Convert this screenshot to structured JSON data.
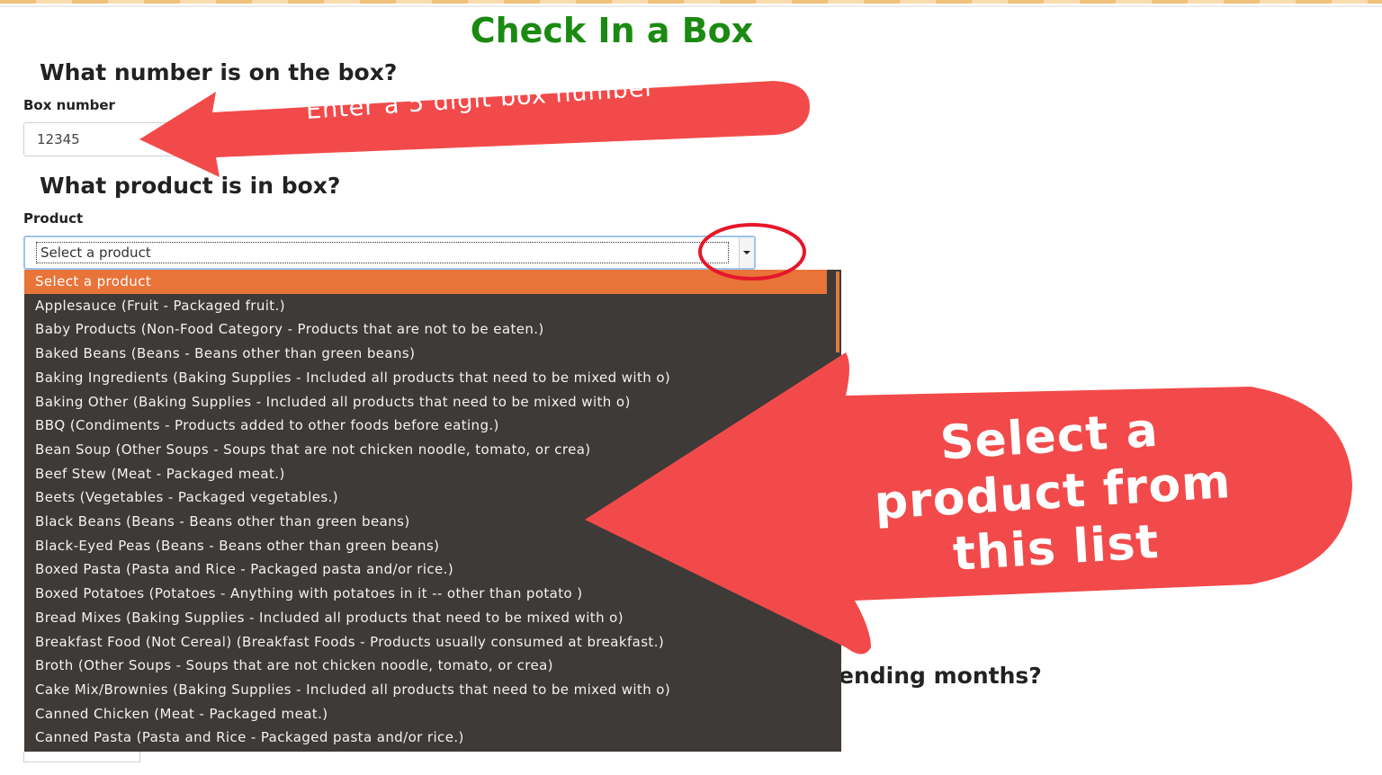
{
  "page": {
    "title": "Check In a Box"
  },
  "box_section": {
    "heading": "What number is on the box?",
    "label": "Box number",
    "value": "12345"
  },
  "product_section": {
    "heading": "What product is in box?",
    "label": "Product",
    "selected": "Select a product",
    "options": [
      "Select a product",
      "Applesauce (Fruit - Packaged fruit.)",
      "Baby Products (Non-Food Category - Products that are not to be eaten.)",
      "Baked Beans (Beans - Beans other than green beans)",
      "Baking Ingredients (Baking Supplies - Included all products that need to be mixed with o)",
      "Baking Other (Baking Supplies - Included all products that need to be mixed with o)",
      "BBQ (Condiments - Products added to other foods before eating.)",
      "Bean Soup (Other Soups - Soups that are not chicken noodle, tomato, or crea)",
      "Beef Stew (Meat - Packaged meat.)",
      "Beets (Vegetables - Packaged vegetables.)",
      "Black Beans (Beans - Beans other than green beans)",
      "Black-Eyed Peas (Beans - Beans other than green beans)",
      "Boxed Pasta (Pasta and Rice - Packaged pasta and/or rice.)",
      "Boxed Potatoes (Potatoes - Anything with potatoes in it -- other than potato )",
      "Bread Mixes (Baking Supplies - Included all products that need to be mixed with o)",
      "Breakfast Food (Not Cereal) (Breakfast Foods - Products usually consumed at breakfast.)",
      "Broth (Other Soups - Soups that are not chicken noodle, tomato, or crea)",
      "Cake Mix/Brownies (Baking Supplies - Included all products that need to be mixed with o)",
      "Canned Chicken (Meat - Packaged meat.)",
      "Canned Pasta (Pasta and Rice - Packaged pasta and/or rice.)"
    ]
  },
  "hidden_section": {
    "heading_fragment": "ending months?"
  },
  "annotations": {
    "box_hint": "Enter a 5 digit box number",
    "product_hint": "Select a product from this list",
    "arrow_color": "#f24a4a",
    "circle_color": "#e5172a"
  },
  "colors": {
    "title": "#1b8a12",
    "dropdown_bg": "#3d3a37",
    "dropdown_selected": "#e8743a"
  }
}
